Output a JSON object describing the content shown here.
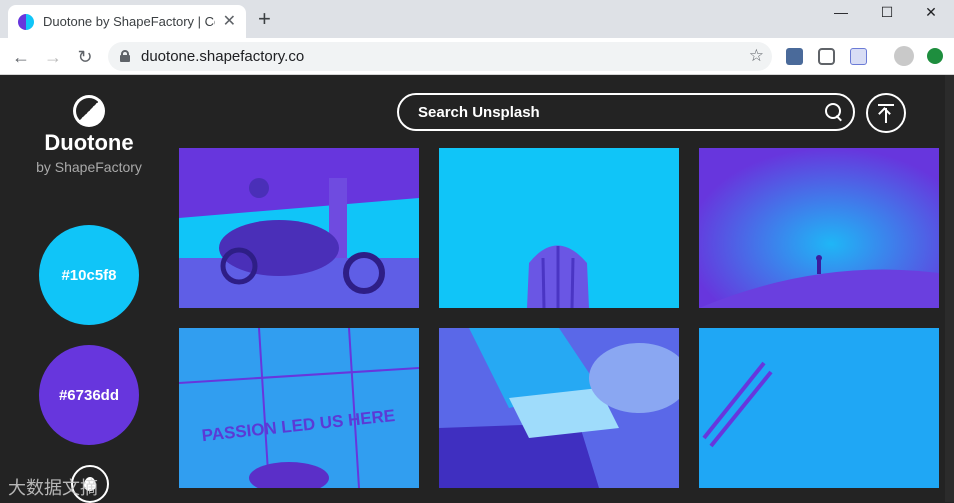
{
  "browser": {
    "tab_title": "Duotone by ShapeFactory | Co",
    "url": "duotone.shapefactory.co",
    "new_tab_glyph": "+",
    "tab_close_glyph": "✕",
    "minimize_glyph": "—",
    "maximize_glyph": "☐",
    "close_glyph": "✕",
    "back_glyph": "←",
    "forward_glyph": "→",
    "reload_glyph": "↻",
    "star_glyph": "☆"
  },
  "app": {
    "brand": "Duotone",
    "brand_sub": "by ShapeFactory",
    "search_label": "Search Unsplash",
    "swatches": [
      {
        "label": "#10c5f8",
        "color": "#10c5f8"
      },
      {
        "label": "#6736dd",
        "color": "#6736dd"
      }
    ],
    "photos": [
      {
        "subject": "motorcycle rider under bridge"
      },
      {
        "subject": "cactus"
      },
      {
        "subject": "starry night sky with person"
      },
      {
        "subject": "passion led us here",
        "overlay_text": "PASSION LED US HERE"
      },
      {
        "subject": "laptop and notebook on desk"
      },
      {
        "subject": "pencils"
      }
    ]
  },
  "watermark": "大数据文摘",
  "colors": {
    "light": "#10c5f8",
    "dark": "#6736dd",
    "background": "#232323"
  }
}
